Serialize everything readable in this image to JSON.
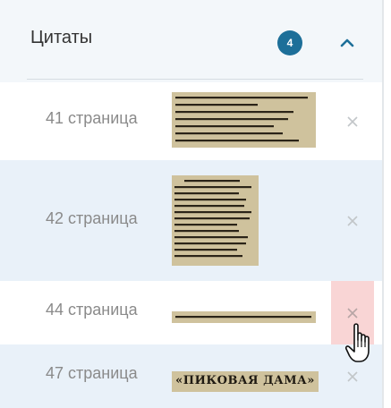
{
  "panel": {
    "title": "Цитаты",
    "count": "4",
    "collapse_icon": "chevron-up-icon",
    "accent_color": "#1d6f99"
  },
  "quotes": [
    {
      "label": "41 страница",
      "remove_icon": "close-icon"
    },
    {
      "label": "42 страница",
      "remove_icon": "close-icon"
    },
    {
      "label": "44 страница",
      "remove_icon": "close-icon"
    },
    {
      "label": "47 страница",
      "remove_icon": "close-icon",
      "clip_text": "«ПИКОВАЯ ДАМА»"
    }
  ]
}
